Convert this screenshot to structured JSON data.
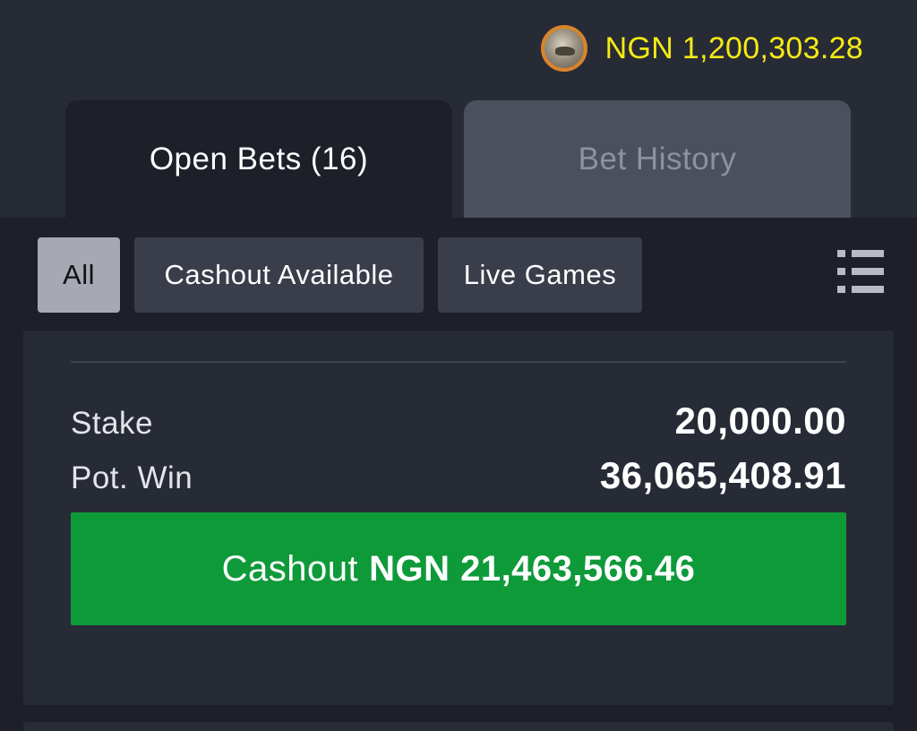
{
  "header": {
    "avatar_icon": "user-avatar-icon",
    "balance": "NGN 1,200,303.28",
    "balance_color": "#f5ea14"
  },
  "tabs": [
    {
      "label": "Open Bets (16)",
      "active": true
    },
    {
      "label": "Bet History",
      "active": false
    }
  ],
  "filters": {
    "items": [
      {
        "label": "All",
        "selected": true
      },
      {
        "label": "Cashout Available",
        "selected": false
      },
      {
        "label": "Live Games",
        "selected": false
      }
    ],
    "view_toggle_icon": "list-view-icon"
  },
  "bet": {
    "stake_label": "Stake",
    "stake_value": "20,000.00",
    "potwin_label": "Pot. Win",
    "potwin_value": "36,065,408.91",
    "cashout_prefix": "Cashout",
    "cashout_amount": "NGN 21,463,566.46",
    "cashout_color": "#0f9a3a"
  }
}
